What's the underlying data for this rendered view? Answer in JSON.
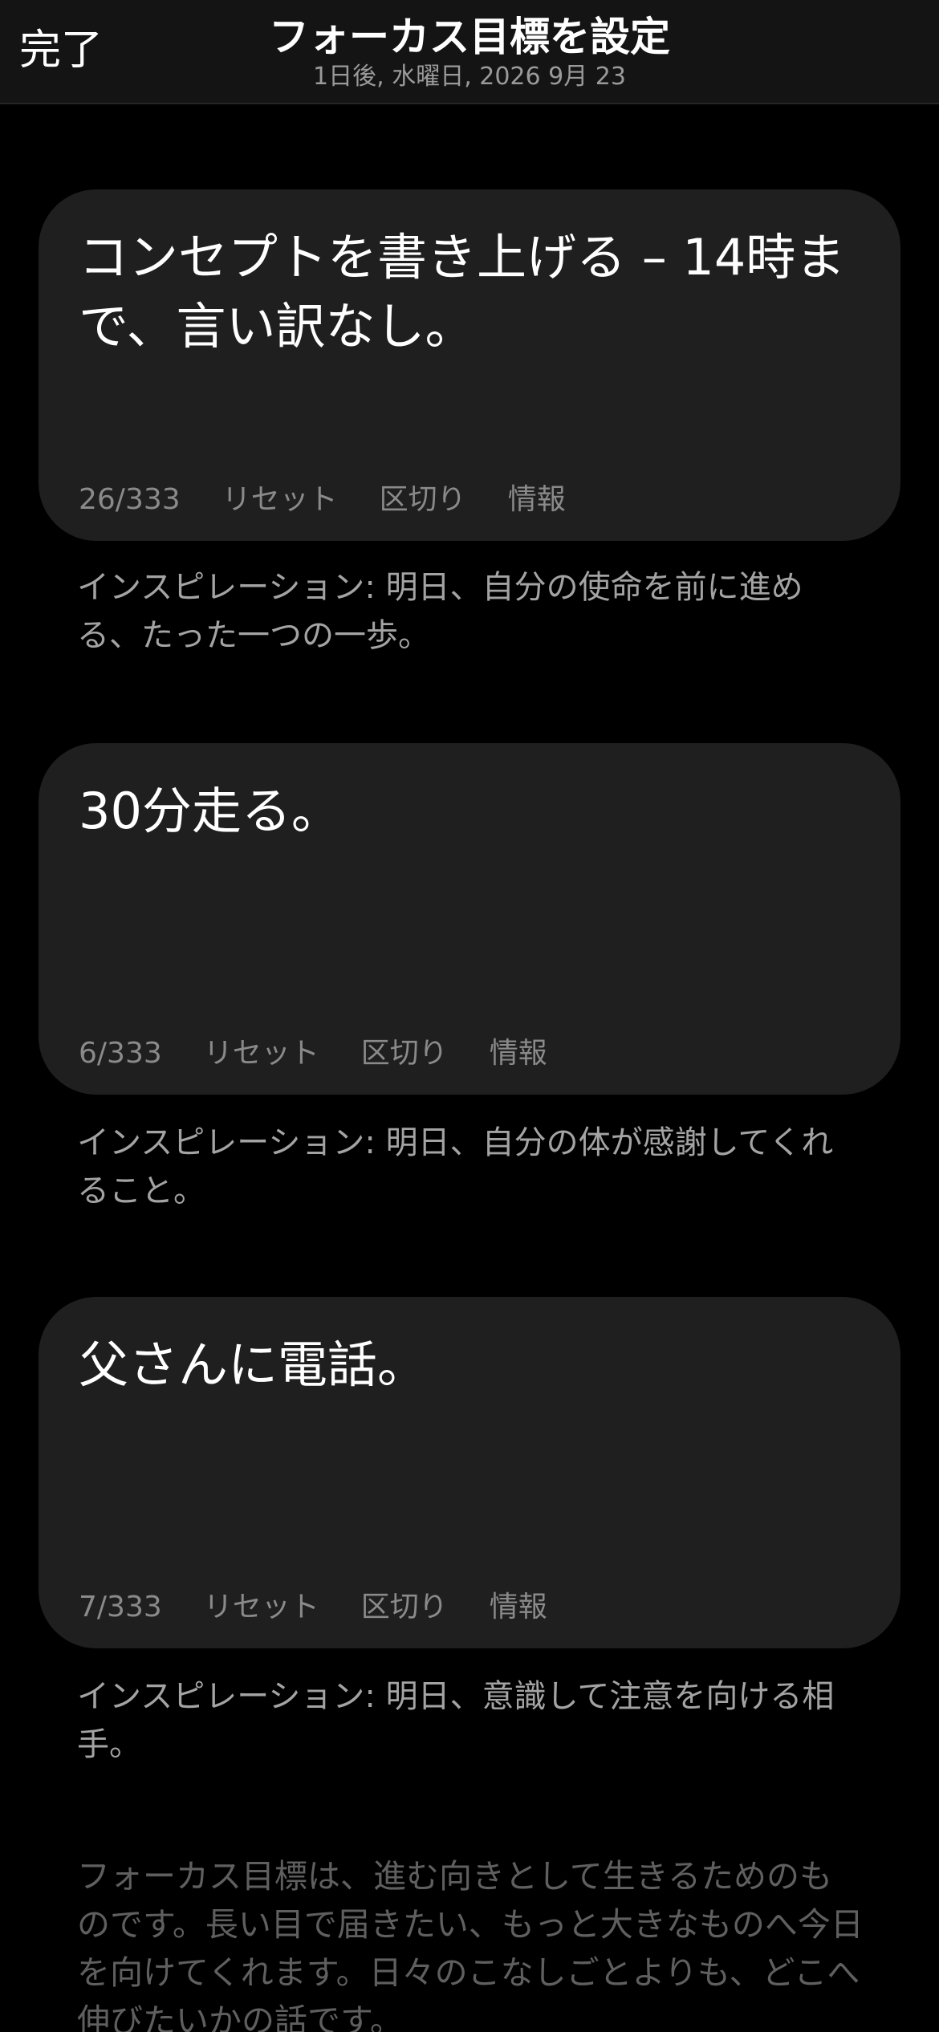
{
  "header": {
    "done_label": "完了",
    "title": "フォーカス目標を設定",
    "subtitle": "1日後, 水曜日, 2026 9月 23"
  },
  "goals": [
    {
      "text": "コンセプトを書き上げる – 14時まで、言い訳なし。",
      "counter": "26/333",
      "reset_label": "リセット",
      "separator_label": "区切り",
      "info_label": "情報",
      "inspiration": "インスピレーション: 明日、自分の使命を前に進める、たった一つの一歩。"
    },
    {
      "text": "30分走る。",
      "counter": "6/333",
      "reset_label": "リセット",
      "separator_label": "区切り",
      "info_label": "情報",
      "inspiration": "インスピレーション: 明日、自分の体が感謝してくれること。"
    },
    {
      "text": "父さんに電話。",
      "counter": "7/333",
      "reset_label": "リセット",
      "separator_label": "区切り",
      "info_label": "情報",
      "inspiration": "インスピレーション: 明日、意識して注意を向ける相手。"
    }
  ],
  "footer_note": "フォーカス目標は、進む向きとして生きるためのものです。長い目で届きたい、もっと大きなものへ今日を向けてくれます。日々のこなしごとよりも、どこへ伸びたいかの話です。"
}
